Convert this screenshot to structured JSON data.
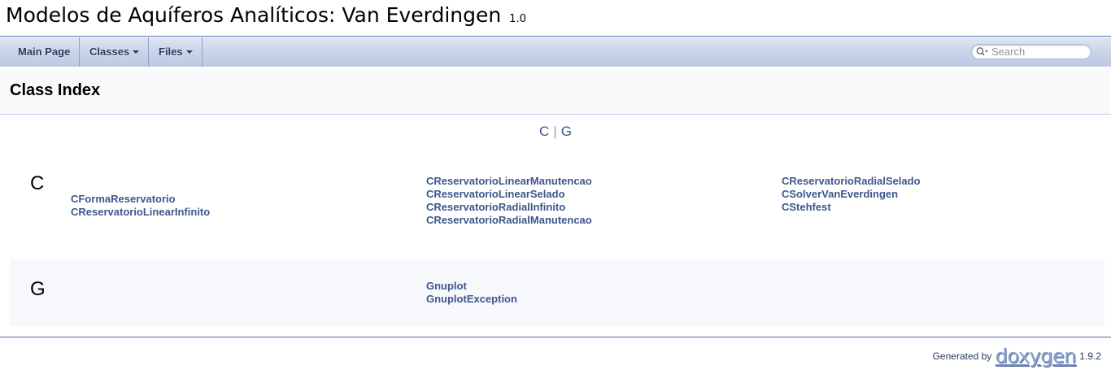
{
  "project": {
    "name": "Modelos de Aquíferos Analíticos: Van Everdingen",
    "number": "1.0"
  },
  "nav": {
    "items": [
      {
        "label": "Main Page",
        "has_dropdown": false
      },
      {
        "label": "Classes",
        "has_dropdown": true
      },
      {
        "label": "Files",
        "has_dropdown": true
      }
    ],
    "search_placeholder": "Search",
    "search_icon": "search-icon"
  },
  "header": {
    "title": "Class Index"
  },
  "letters": [
    "C",
    "G"
  ],
  "letters_separator": "|",
  "groups": {
    "c": {
      "letter": "C",
      "col1": [
        "CFormaReservatorio",
        "CReservatorioLinearInfinito"
      ],
      "col2": [
        "CReservatorioLinearManutencao",
        "CReservatorioLinearSelado",
        "CReservatorioRadialInfinito",
        "CReservatorioRadialManutencao"
      ],
      "col3": [
        "CReservatorioRadialSelado",
        "CSolverVanEverdingen",
        "CStehfest"
      ]
    },
    "g": {
      "letter": "G",
      "col2": [
        "Gnuplot",
        "GnuplotException"
      ]
    }
  },
  "footer": {
    "generated_by": "Generated by",
    "logo": "doxygen",
    "version": "1.9.2"
  },
  "colors": {
    "link": "#3d578c",
    "nav_text": "#283a5d",
    "nav_gradient_top": "#dfe5f1",
    "nav_gradient_bottom": "#bdc9e2",
    "title_border": "#5373b4"
  }
}
